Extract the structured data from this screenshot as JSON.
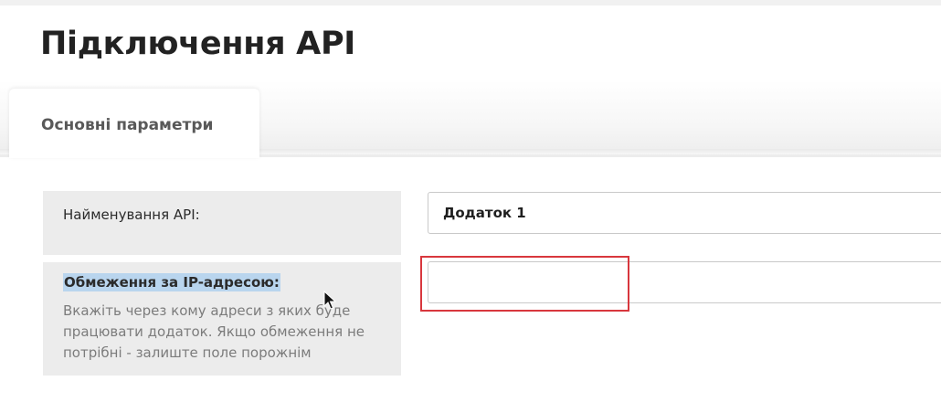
{
  "page": {
    "title": "Підключення API"
  },
  "tabs": [
    {
      "label": "Основні параметри",
      "active": true
    }
  ],
  "form": {
    "api_name": {
      "label": "Найменування API:",
      "value": "Додаток 1"
    },
    "ip_restriction": {
      "label": "Обмеження за IP-адресою:",
      "description": "Вкажіть через кому адреси з яких буде працювати додаток. Якщо обмеження не потрібні - залиште поле порожнім",
      "value": ""
    }
  },
  "colors": {
    "label_cell_bg": "#ececec",
    "selection_highlight": "#b9d5ee",
    "annotation_red": "#d8373d"
  },
  "icons": {
    "cursor": "mouse-pointer-icon"
  }
}
